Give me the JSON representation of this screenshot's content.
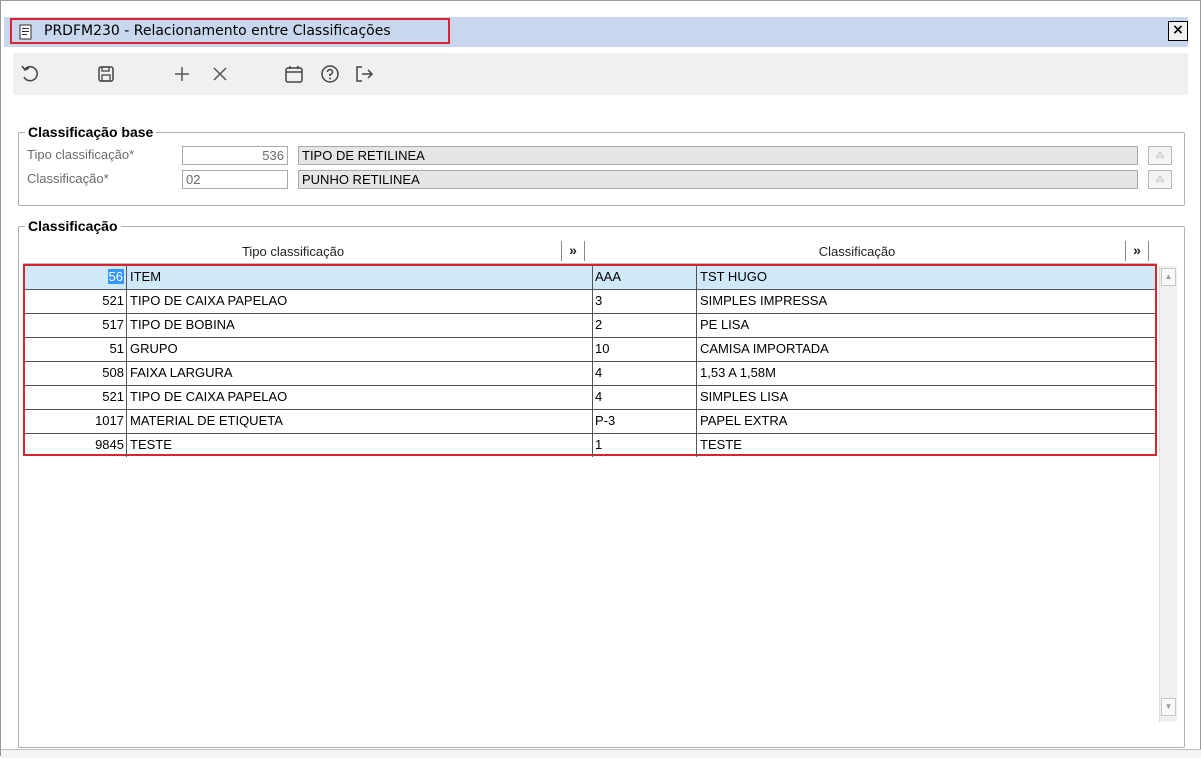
{
  "window": {
    "title": "PRDFM230 - Relacionamento entre Classificações",
    "close_label": "×"
  },
  "toolbar": {
    "buttons": [
      "undo-icon",
      "save-icon",
      "add-icon",
      "delete-icon",
      "calendar-icon",
      "help-icon",
      "exit-icon"
    ]
  },
  "base_group": {
    "label": "Classificação base",
    "tipo_label": "Tipo classificação*",
    "tipo_value": "536",
    "tipo_desc": "TIPO DE RETILINEA",
    "class_label": "Classificação*",
    "class_value": "02",
    "class_desc": "PUNHO RETILINEA"
  },
  "grid_group": {
    "label": "Classificação",
    "col_tipo": "Tipo classificação",
    "col_class": "Classificação",
    "expand": "»",
    "rows": [
      {
        "num": "56",
        "tipo": "ITEM",
        "code": "AAA",
        "desc": "TST HUGO"
      },
      {
        "num": "521",
        "tipo": "TIPO DE CAIXA PAPELAO",
        "code": "3",
        "desc": "SIMPLES IMPRESSA"
      },
      {
        "num": "517",
        "tipo": "TIPO DE BOBINA",
        "code": "2",
        "desc": "PE LISA"
      },
      {
        "num": "51",
        "tipo": "GRUPO",
        "code": "10",
        "desc": "CAMISA IMPORTADA"
      },
      {
        "num": "508",
        "tipo": "FAIXA LARGURA",
        "code": "4",
        "desc": "1,53 A 1,58M"
      },
      {
        "num": "521",
        "tipo": "TIPO DE CAIXA PAPELAO",
        "code": "4",
        "desc": "SIMPLES LISA"
      },
      {
        "num": "1017",
        "tipo": "MATERIAL DE ETIQUETA",
        "code": "P-3",
        "desc": "PAPEL EXTRA"
      },
      {
        "num": "9845",
        "tipo": "TESTE",
        "code": "1",
        "desc": "TESTE"
      }
    ]
  },
  "colors": {
    "titlebar": "#c8d7ee",
    "highlight": "#d9232d",
    "selected_row": "#cfe9fb"
  }
}
